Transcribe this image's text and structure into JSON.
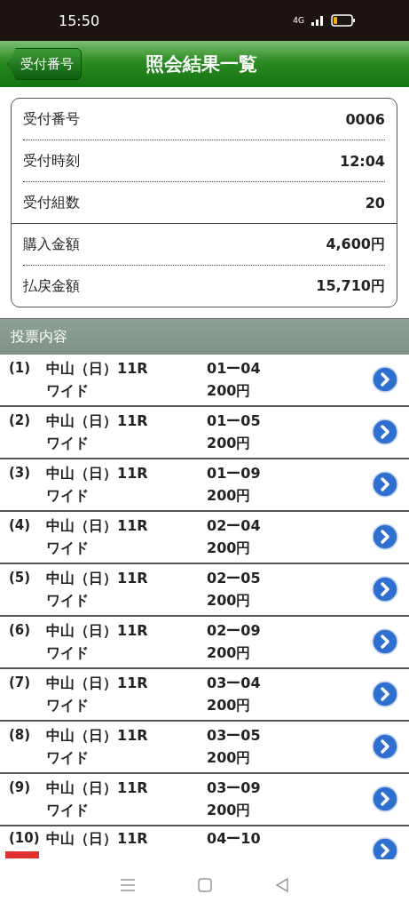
{
  "status_bar": {
    "time": "15:50",
    "network": "4G"
  },
  "header": {
    "back_button": "受付番号",
    "title": "照会結果一覧"
  },
  "summary": [
    [
      {
        "label": "受付番号",
        "value": "0006"
      },
      {
        "label": "受付時刻",
        "value": "12:04"
      },
      {
        "label": "受付組数",
        "value": "20"
      }
    ],
    [
      {
        "label": "購入金額",
        "value": "4,600円"
      },
      {
        "label": "払戻金額",
        "value": "15,710円"
      }
    ]
  ],
  "section_title": "投票内容",
  "bets": [
    {
      "no": "(1)",
      "race": "中山（日）11R",
      "type": "ワイド",
      "combo": "01ー04",
      "amount": "200円",
      "hit": false
    },
    {
      "no": "(2)",
      "race": "中山（日）11R",
      "type": "ワイド",
      "combo": "01ー05",
      "amount": "200円",
      "hit": false
    },
    {
      "no": "(3)",
      "race": "中山（日）11R",
      "type": "ワイド",
      "combo": "01ー09",
      "amount": "200円",
      "hit": false
    },
    {
      "no": "(4)",
      "race": "中山（日）11R",
      "type": "ワイド",
      "combo": "02ー04",
      "amount": "200円",
      "hit": false
    },
    {
      "no": "(5)",
      "race": "中山（日）11R",
      "type": "ワイド",
      "combo": "02ー05",
      "amount": "200円",
      "hit": false
    },
    {
      "no": "(6)",
      "race": "中山（日）11R",
      "type": "ワイド",
      "combo": "02ー09",
      "amount": "200円",
      "hit": false
    },
    {
      "no": "(7)",
      "race": "中山（日）11R",
      "type": "ワイド",
      "combo": "03ー04",
      "amount": "200円",
      "hit": false
    },
    {
      "no": "(8)",
      "race": "中山（日）11R",
      "type": "ワイド",
      "combo": "03ー05",
      "amount": "200円",
      "hit": false
    },
    {
      "no": "(9)",
      "race": "中山（日）11R",
      "type": "ワイド",
      "combo": "03ー09",
      "amount": "200円",
      "hit": false
    },
    {
      "no": "(10)",
      "race": "中山（日）11R",
      "combo": "04ー10",
      "hit": true
    }
  ]
}
